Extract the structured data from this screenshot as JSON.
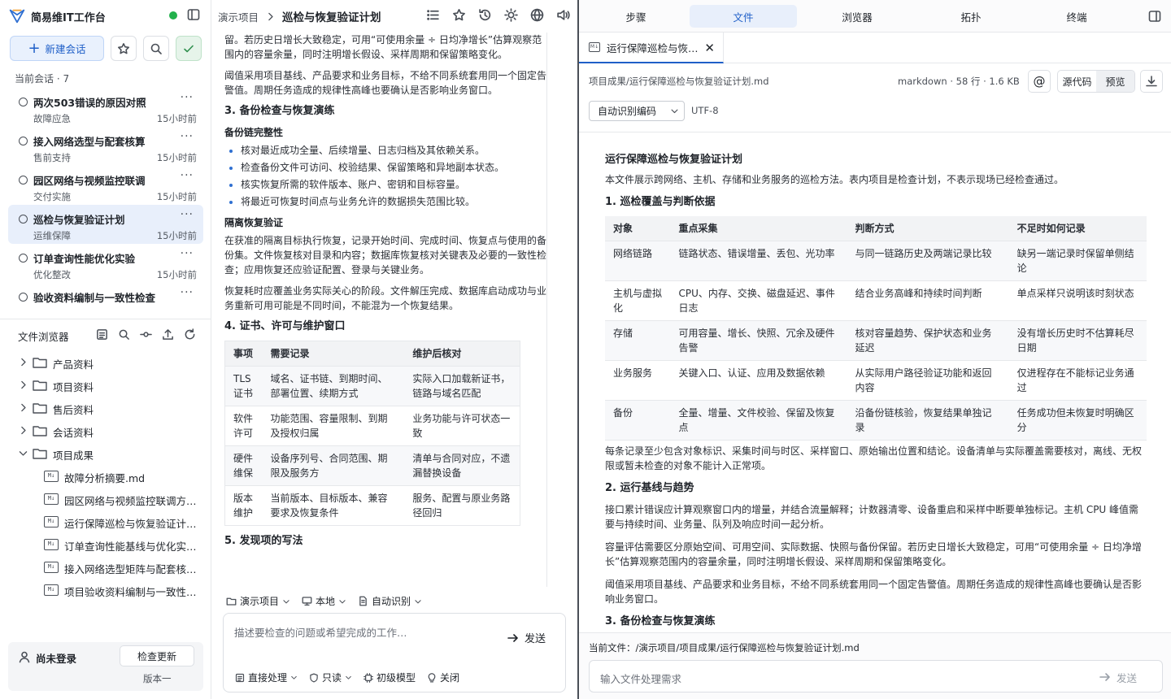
{
  "app": {
    "title": "简易维IT工作台"
  },
  "sidebar": {
    "new_chat": "新建会话",
    "sessions_header": "当前会话 · 7",
    "sessions": [
      {
        "title": "两次503错误的原因对照",
        "category": "故障应急",
        "time": "15小时前",
        "active": false
      },
      {
        "title": "接入网络选型与配套核算",
        "category": "售前支持",
        "time": "15小时前",
        "active": false
      },
      {
        "title": "园区网络与视频监控联调",
        "category": "交付实施",
        "time": "15小时前",
        "active": false
      },
      {
        "title": "巡检与恢复验证计划",
        "category": "运维保障",
        "time": "15小时前",
        "active": true
      },
      {
        "title": "订单查询性能优化实验",
        "category": "优化整改",
        "time": "15小时前",
        "active": false
      },
      {
        "title": "验收资料编制与一致性检查",
        "category": "交付验收",
        "time": "15小时前",
        "active": false
      }
    ],
    "file_browser_title": "文件浏览器",
    "tree": [
      {
        "label": "产品资料",
        "type": "folder",
        "open": false
      },
      {
        "label": "项目资料",
        "type": "folder",
        "open": false
      },
      {
        "label": "售后资料",
        "type": "folder",
        "open": false
      },
      {
        "label": "会话资料",
        "type": "folder",
        "open": false
      },
      {
        "label": "项目成果",
        "type": "folder",
        "open": true
      },
      {
        "label": "故障分析摘要.md",
        "type": "file"
      },
      {
        "label": "园区网络与视频监控联调方案.md",
        "type": "file"
      },
      {
        "label": "运行保障巡检与恢复验证计划.md",
        "type": "file"
      },
      {
        "label": "订单查询性能基线与优化实验.md",
        "type": "file"
      },
      {
        "label": "接入网络选型矩阵与配套核算.md",
        "type": "file"
      },
      {
        "label": "项目验收资料编制与一致性检查.md",
        "type": "file"
      }
    ],
    "user": {
      "name": "尚未登录",
      "update_label": "检查更新",
      "version": "版本一"
    }
  },
  "middle": {
    "breadcrumb_root": "演示项目",
    "breadcrumb_current": "巡检与恢复验证计划",
    "intro_p1": "留。若历史日增长大致稳定，可用“可使用余量 ÷ 日均净增长”估算观察范围内的容量余量，同时注明增长假设、采样周期和保留策略变化。",
    "intro_p2": "阈值采用项目基线、产品要求和业务目标，不给不同系统套用同一个固定告警值。周期任务造成的规律性高峰也要确认是否影响业务窗口。",
    "s3_title": "3. 备份检查与恢复演练",
    "s3_sub1": "备份链完整性",
    "s3_bullets": [
      "核对最近成功全量、后续增量、日志归档及其依赖关系。",
      "检查备份文件可访问、校验结果、保留策略和异地副本状态。",
      "核实恢复所需的软件版本、账户、密钥和目标容量。",
      "将最近可恢复时间点与业务允许的数据损失范围比较。"
    ],
    "s3_sub2": "隔离恢复验证",
    "s3_p1": "在获准的隔离目标执行恢复，记录开始时间、完成时间、恢复点与使用的备份集。文件恢复核对目录和内容；数据库恢复核对关键表及必要的一致性检查；应用恢复还应验证配置、登录与关键业务。",
    "s3_p2": "恢复耗时应覆盖业务实际关心的阶段。文件解压完成、数据库启动成功与业务重新可用可能是不同时间，不能混为一个恢复结果。",
    "s4_title": "4. 证书、许可与维护窗口",
    "table": {
      "headers": [
        "事项",
        "需要记录",
        "维护后核对"
      ],
      "rows": [
        [
          "TLS 证书",
          "域名、证书链、到期时间、部署位置、续期方式",
          "实际入口加载新证书，链路与域名匹配"
        ],
        [
          "软件许可",
          "功能范围、容量限制、到期及授权归属",
          "业务功能与许可状态一致"
        ],
        [
          "硬件维保",
          "设备序列号、合同范围、期限及服务方",
          "清单与合同对应，不遗漏替换设备"
        ],
        [
          "版本维护",
          "当前版本、目标版本、兼容要求及恢复条件",
          "服务、配置与原业务路径回归"
        ]
      ]
    },
    "s5_title": "5. 发现项的写法",
    "ctx": {
      "project": "演示项目",
      "location": "本地",
      "mode": "自动识别"
    },
    "composer": {
      "placeholder": "描述要检查的问题或希望完成的工作…",
      "send": "发送",
      "opts": [
        "直接处理",
        "只读",
        "初级模型",
        "关闭"
      ]
    }
  },
  "right": {
    "tabs": [
      "步骤",
      "文件",
      "浏览器",
      "拓扑",
      "终端"
    ],
    "file_tab": "运行保障巡检与恢…",
    "path": "项目成果/运行保障巡检与恢复验证计划.md",
    "meta": "markdown · 58 行 · 1.6 KB",
    "at": "@",
    "view_source": "源代码",
    "view_preview": "预览",
    "encoding_select": "自动识别编码",
    "encoding_value": "UTF-8",
    "doc": {
      "title": "运行保障巡检与恢复验证计划",
      "intro": "本文件展示跨网络、主机、存储和业务服务的巡检方法。表内项目是检查计划，不表示现场已经检查通过。",
      "s1_title": "1. 巡检覆盖与判断依据",
      "table": {
        "headers": [
          "对象",
          "重点采集",
          "判断方式",
          "不足时如何记录"
        ],
        "rows": [
          [
            "网络链路",
            "链路状态、错误增量、丢包、光功率",
            "与同一链路历史及两端记录比较",
            "缺另一端记录时保留单侧结论"
          ],
          [
            "主机与虚拟化",
            "CPU、内存、交换、磁盘延迟、事件日志",
            "结合业务高峰和持续时间判断",
            "单点采样只说明该时刻状态"
          ],
          [
            "存储",
            "可用容量、增长、快照、冗余及硬件告警",
            "核对容量趋势、保护状态和业务延迟",
            "没有增长历史时不估算耗尽日期"
          ],
          [
            "业务服务",
            "关键入口、认证、应用及数据依赖",
            "从实际用户路径验证功能和返回内容",
            "仅进程存在不能标记业务通过"
          ],
          [
            "备份",
            "全量、增量、文件校验、保留及恢复点",
            "沿备份链核验，恢复结果单独记录",
            "任务成功但未恢复时明确区分"
          ]
        ]
      },
      "p_after_table": "每条记录至少包含对象标识、采集时间与时区、采样窗口、原始输出位置和结论。设备清单与实际覆盖需要核对，离线、无权限或暂未检查的对象不能计入正常项。",
      "s2_title": "2. 运行基线与趋势",
      "s2_p1": "接口累计错误应计算观察窗口内的增量，并结合流量解释；计数器清零、设备重启和采样中断要单独标记。主机 CPU 峰值需要与持续时间、业务量、队列及响应时间一起分析。",
      "s2_p2": "容量评估需要区分原始空间、可用空间、实际数据、快照与备份保留。若历史日增长大致稳定，可用“可使用余量 ÷ 日均净增长”估算观察范围内的容量余量，同时注明增长假设、采样周期和保留策略变化。",
      "s2_p3": "阈值采用项目基线、产品要求和业务目标，不给不同系统套用同一个固定告警值。周期任务造成的规律性高峰也要确认是否影响业务窗口。",
      "s3_title": "3. 备份检查与恢复演练"
    },
    "current_file": "当前文件：/演示项目/项目成果/运行保障巡检与恢复验证计划.md",
    "input_placeholder": "输入文件处理需求",
    "send": "发送"
  }
}
